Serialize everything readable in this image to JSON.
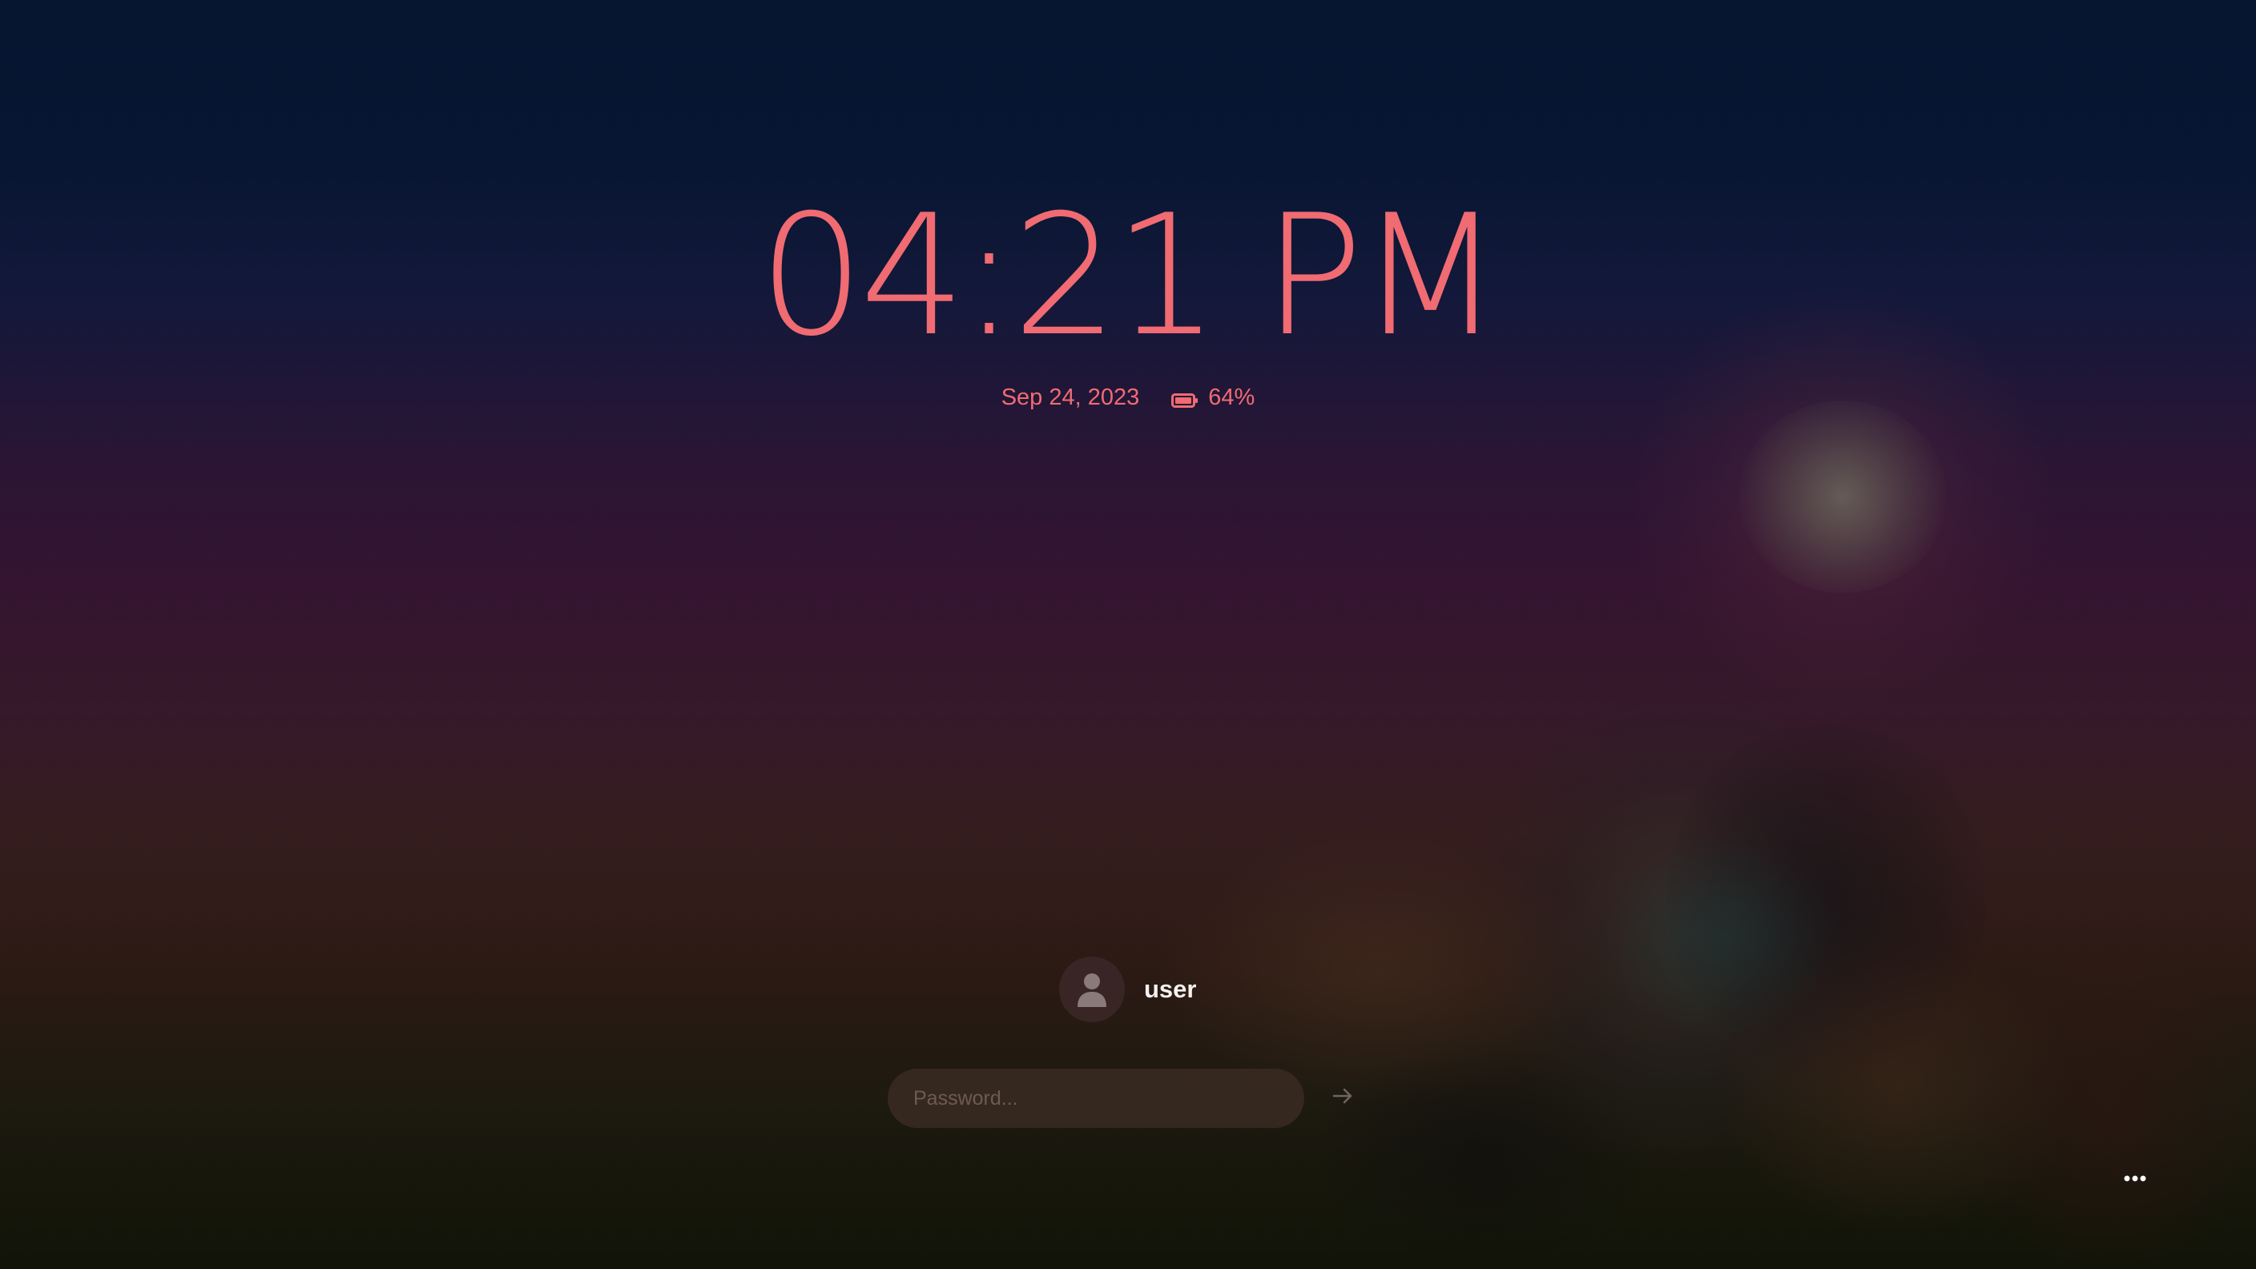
{
  "lockscreen": {
    "time": "04:21 PM",
    "date": "Sep 24, 2023",
    "battery": {
      "icon": "battery-icon",
      "label": "64%",
      "level_percent": 64
    }
  },
  "login": {
    "avatar_icon": "user-avatar-icon",
    "username": "user",
    "password": {
      "value": "",
      "placeholder": "Password..."
    },
    "submit_icon": "arrow-right-icon"
  },
  "controls": {
    "more_icon": "more-horizontal-icon"
  },
  "colors": {
    "accent": "#f06b72",
    "username_text": "#f4f1f1",
    "input_background": "#3e2e24",
    "placeholder": "#6e5a52"
  }
}
